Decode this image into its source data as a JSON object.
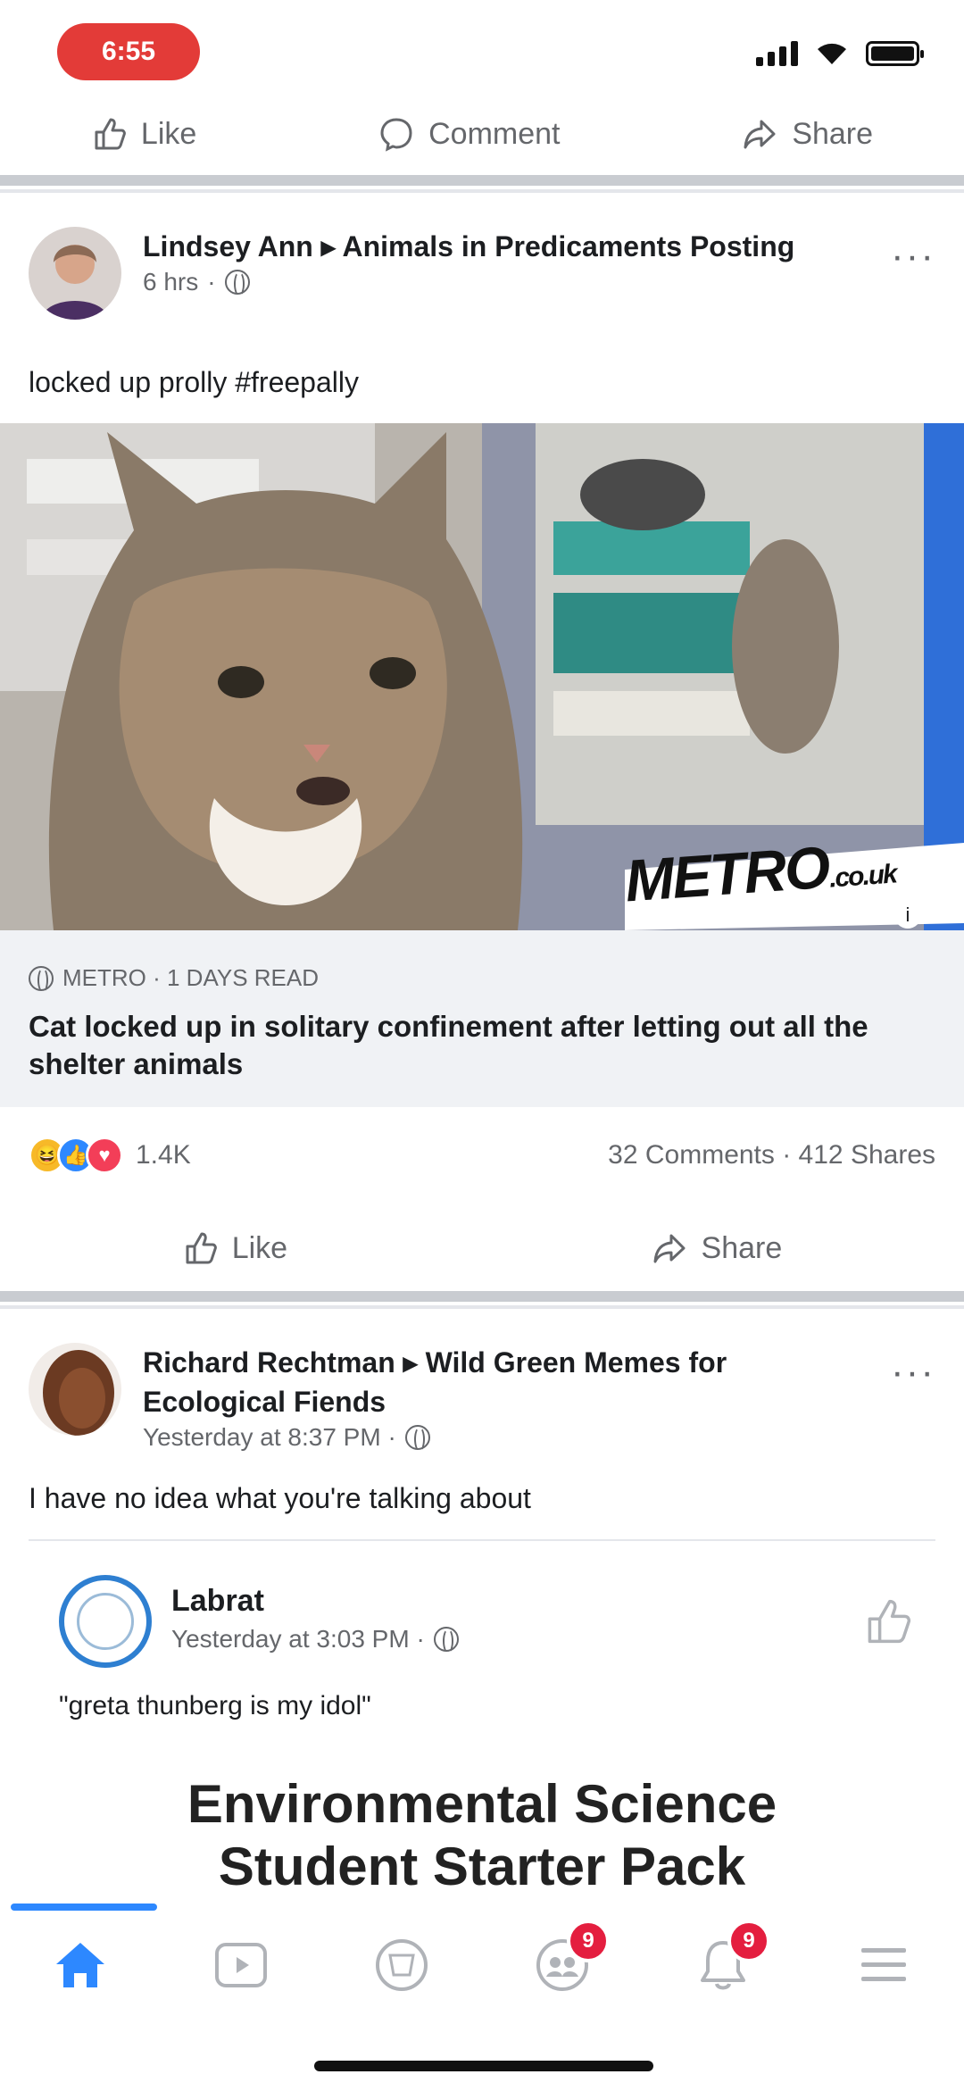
{
  "status_bar": {
    "time": "6:55"
  },
  "top_actions": {
    "like": "Like",
    "comment": "Comment",
    "share": "Share"
  },
  "post1": {
    "author": "Lindsey Ann ▸ Animals in Predicaments Posting",
    "time": "6 hrs",
    "text": "locked up prolly #freepally",
    "link_source": "METRO · 1 DAYS READ",
    "link_title": "Cat locked up in solitary confinement after letting out all the shelter animals",
    "watermark": "METRO",
    "watermark_suffix": ".co.uk",
    "reactions_count": "1.4K",
    "comments_shares": "32 Comments · 412 Shares",
    "like_label": "Like",
    "share_label": "Share"
  },
  "post2": {
    "author": "Richard Rechtman ▸ Wild Green Memes for Ecological Fiends",
    "time": "Yesterday at 8:37 PM ·",
    "text": "I have no idea what you're talking about",
    "embed_name": "Labrat",
    "embed_time": "Yesterday at 3:03 PM ·",
    "embed_quote": "\"greta thunberg is my idol\"",
    "embed_headline_1": "Environmental Science",
    "embed_headline_2": "Student Starter Pack"
  },
  "bottom_nav": {
    "items": [
      "home",
      "watch",
      "marketplace",
      "groups",
      "notifications",
      "menu"
    ],
    "groups_badge": "9",
    "notifications_badge": "9"
  },
  "colors": {
    "accent": "#2d88ff",
    "badge": "#e41e3f",
    "time_pill": "#e33b38"
  }
}
